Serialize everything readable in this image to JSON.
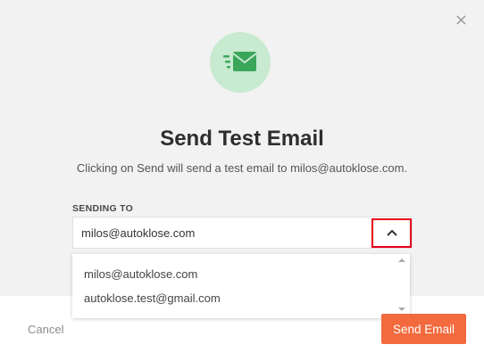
{
  "modal": {
    "close_glyph": "×",
    "title": "Send Test Email",
    "subtitle": "Clicking on Send will send a test email to milos@autoklose.com.",
    "icon": "email-send-icon",
    "icon_colors": {
      "circle": "#c7ead0",
      "envelope": "#3aa65a"
    }
  },
  "sending_to": {
    "label": "SENDING TO",
    "selected_value": "milos@autoklose.com",
    "options": [
      "milos@autoklose.com",
      "autoklose.test@gmail.com"
    ],
    "toggle_icon": "chevron-up-icon"
  },
  "footer": {
    "cancel_label": "Cancel",
    "send_label": "Send Email",
    "send_color": "#f26a3d"
  }
}
